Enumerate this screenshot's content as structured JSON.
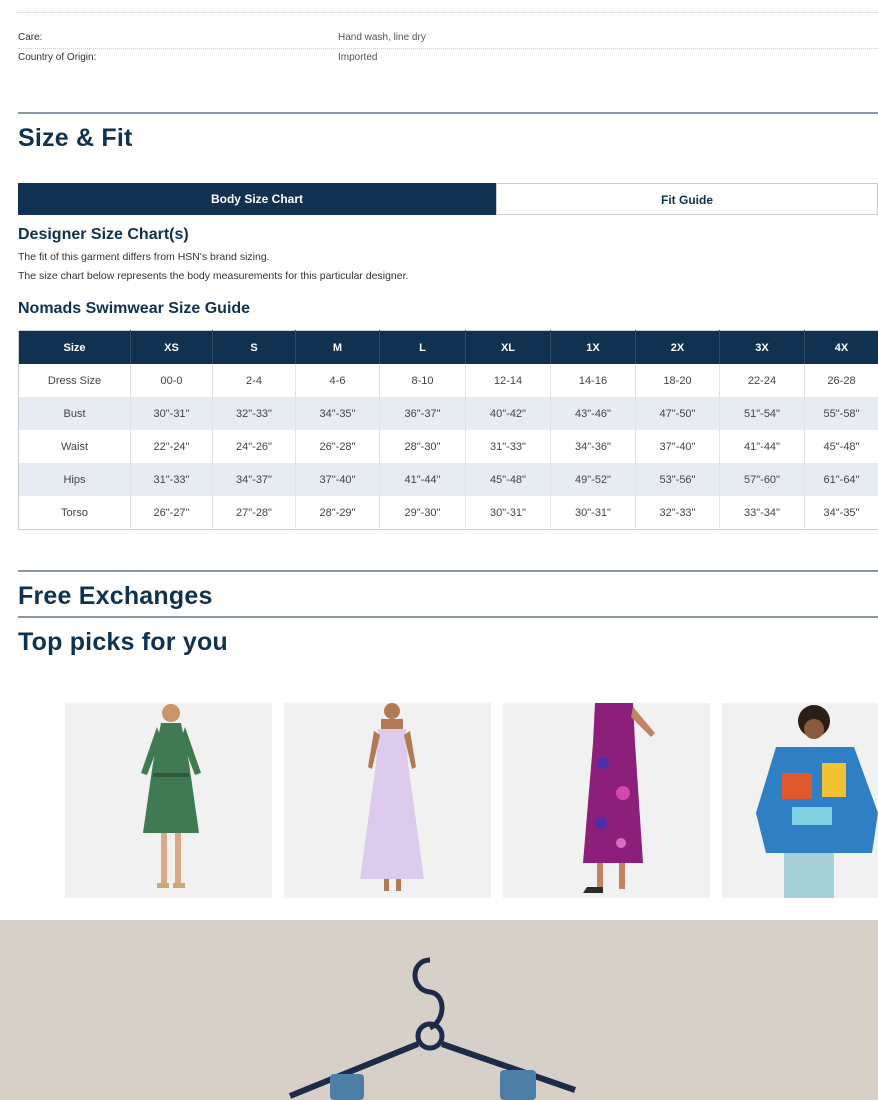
{
  "details": {
    "rows": [
      {
        "key": "Care:",
        "value": "Hand wash, line dry"
      },
      {
        "key": "Country of Origin:",
        "value": "Imported"
      }
    ]
  },
  "size_fit": {
    "heading": "Size & Fit",
    "tabs": [
      {
        "label": "Body Size Chart",
        "active": true
      },
      {
        "label": "Fit Guide",
        "active": false
      }
    ],
    "designer_heading": "Designer Size Chart(s)",
    "notes": [
      "The fit of this garment differs from HSN's brand sizing.",
      "The size chart below represents the body measurements for this particular designer."
    ],
    "guide_heading": "Nomads Swimwear Size Guide",
    "table": {
      "headers": [
        "Size",
        "XS",
        "S",
        "M",
        "L",
        "XL",
        "1X",
        "2X",
        "3X",
        "4X"
      ],
      "rows": [
        [
          "Dress Size",
          "00-0",
          "2-4",
          "4-6",
          "8-10",
          "12-14",
          "14-16",
          "18-20",
          "22-24",
          "26-28"
        ],
        [
          "Bust",
          "30\"-31\"",
          "32\"-33\"",
          "34\"-35\"",
          "36\"-37\"",
          "40\"-42\"",
          "43\"-46\"",
          "47\"-50\"",
          "51\"-54\"",
          "55\"-58\""
        ],
        [
          "Waist",
          "22\"-24\"",
          "24\"-26\"",
          "26\"-28\"",
          "28\"-30\"",
          "31\"-33\"",
          "34\"-36\"",
          "37\"-40\"",
          "41\"-44\"",
          "45\"-48\""
        ],
        [
          "Hips",
          "31\"-33\"",
          "34\"-37\"",
          "37\"-40\"",
          "41\"-44\"",
          "45\"-48\"",
          "49\"-52\"",
          "53\"-56\"",
          "57\"-60\"",
          "61\"-64\""
        ],
        [
          "Torso",
          "26\"-27\"",
          "27\"-28\"",
          "28\"-29\"",
          "29\"-30\"",
          "30\"-31\"",
          "30\"-31\"",
          "32\"-33\"",
          "33\"-34\"",
          "34\"-35\""
        ]
      ]
    }
  },
  "exchanges": {
    "heading": "Free Exchanges"
  },
  "top_picks": {
    "heading": "Top picks for you",
    "products": [
      {
        "name": "green-shirt-dress",
        "color": "#3f7a52"
      },
      {
        "name": "lavender-tiered-maxi-dress",
        "color": "#d8c8e8"
      },
      {
        "name": "magenta-print-dress",
        "color": "#8b1f7a"
      },
      {
        "name": "colorful-print-top",
        "color": "#2f7fc4"
      }
    ]
  },
  "colors": {
    "navy": "#10314f",
    "row_alt": "#e6ecf2"
  }
}
